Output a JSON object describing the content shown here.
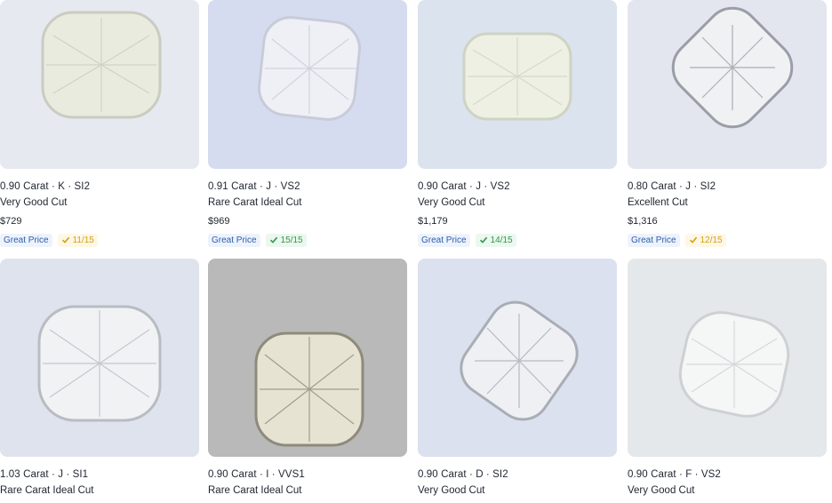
{
  "listings": [
    {
      "line1": "0.90 Carat · K · SI2",
      "line2": "Very Good Cut",
      "price": "$729",
      "deal": "Great Price",
      "score": "11/15",
      "score_color": "#d4a015",
      "bg": "#e6e9f0",
      "stone": "#e9ebdf",
      "stone_edge": "#c9ccc0"
    },
    {
      "line1": "0.91 Carat · J · VS2",
      "line2": "Rare Carat Ideal Cut",
      "price": "$969",
      "deal": "Great Price",
      "score": "15/15",
      "score_color": "#2f9a4a",
      "bg": "#d6dcef",
      "stone": "#eef0f6",
      "stone_edge": "#c8ccd8"
    },
    {
      "line1": "0.90 Carat · J · VS2",
      "line2": "Very Good Cut",
      "price": "$1,179",
      "deal": "Great Price",
      "score": "14/15",
      "score_color": "#2f9a4a",
      "bg": "#dbe3ee",
      "stone": "#edf0e3",
      "stone_edge": "#cfd3c4"
    },
    {
      "line1": "0.80 Carat · J · SI2",
      "line2": "Excellent Cut",
      "price": "$1,316",
      "deal": "Great Price",
      "score": "12/15",
      "score_color": "#d4a015",
      "bg": "#e3e6ef",
      "stone": "#f0f1f3",
      "stone_edge": "#9a9ea6"
    },
    {
      "line1": "1.03 Carat · J · SI1",
      "line2": "Rare Carat Ideal Cut",
      "bg": "#dfe3ee",
      "stone": "#f1f2f4",
      "stone_edge": "#b9bcc2"
    },
    {
      "line1": "0.90 Carat · I · VVS1",
      "line2": "Rare Carat Ideal Cut",
      "bg": "#b9b9b9",
      "stone": "#e6e3d2",
      "stone_edge": "#8e8b7c"
    },
    {
      "line1": "0.90 Carat · D · SI2",
      "line2": "Very Good Cut",
      "bg": "#dbe1ee",
      "stone": "#eef0f4",
      "stone_edge": "#a9adb5"
    },
    {
      "line1": "0.90 Carat · F · VS2",
      "line2": "Very Good Cut",
      "bg": "#e4e8ea",
      "stone": "#f5f6f6",
      "stone_edge": "#cdd1d4"
    }
  ]
}
